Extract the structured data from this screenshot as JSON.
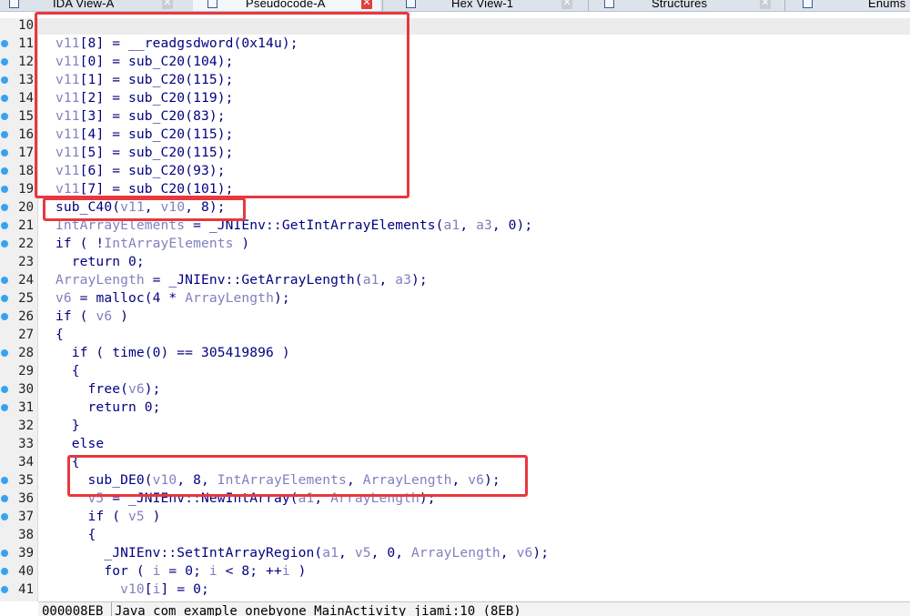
{
  "tabs": [
    {
      "label": "IDA View-A",
      "active": false,
      "icon": "disassembly-icon"
    },
    {
      "label": "Pseudocode-A",
      "active": true,
      "icon": "pseudocode-icon"
    },
    {
      "label": "Hex View-1",
      "active": false,
      "icon": "hex-icon"
    },
    {
      "label": "Structures",
      "active": false,
      "icon": "structures-icon"
    },
    {
      "label": "Enums",
      "active": false,
      "icon": "enums-icon"
    }
  ],
  "close_glyph": "✕",
  "code_lines": [
    {
      "n": "10",
      "dot": false,
      "text": ""
    },
    {
      "n": "11",
      "dot": true,
      "text": "v11[8] = __readgsdword(0x14u);"
    },
    {
      "n": "12",
      "dot": true,
      "text": "v11[0] = sub_C20(104);"
    },
    {
      "n": "13",
      "dot": true,
      "text": "v11[1] = sub_C20(115);"
    },
    {
      "n": "14",
      "dot": true,
      "text": "v11[2] = sub_C20(119);"
    },
    {
      "n": "15",
      "dot": true,
      "text": "v11[3] = sub_C20(83);"
    },
    {
      "n": "16",
      "dot": true,
      "text": "v11[4] = sub_C20(115);"
    },
    {
      "n": "17",
      "dot": true,
      "text": "v11[5] = sub_C20(115);"
    },
    {
      "n": "18",
      "dot": true,
      "text": "v11[6] = sub_C20(93);"
    },
    {
      "n": "19",
      "dot": true,
      "text": "v11[7] = sub_C20(101);"
    },
    {
      "n": "20",
      "dot": true,
      "text": "sub_C40(v11, v10, 8);"
    },
    {
      "n": "21",
      "dot": true,
      "text": "IntArrayElements = _JNIEnv::GetIntArrayElements(a1, a3, 0);"
    },
    {
      "n": "22",
      "dot": true,
      "text": "if ( !IntArrayElements )"
    },
    {
      "n": "23",
      "dot": false,
      "text": "  return 0;"
    },
    {
      "n": "24",
      "dot": true,
      "text": "ArrayLength = _JNIEnv::GetArrayLength(a1, a3);"
    },
    {
      "n": "25",
      "dot": true,
      "text": "v6 = malloc(4 * ArrayLength);"
    },
    {
      "n": "26",
      "dot": true,
      "text": "if ( v6 )"
    },
    {
      "n": "27",
      "dot": false,
      "text": "{"
    },
    {
      "n": "28",
      "dot": true,
      "text": "  if ( time(0) == 305419896 )"
    },
    {
      "n": "29",
      "dot": false,
      "text": "  {"
    },
    {
      "n": "30",
      "dot": true,
      "text": "    free(v6);"
    },
    {
      "n": "31",
      "dot": true,
      "text": "    return 0;"
    },
    {
      "n": "32",
      "dot": false,
      "text": "  }"
    },
    {
      "n": "33",
      "dot": false,
      "text": "  else"
    },
    {
      "n": "34",
      "dot": false,
      "text": "  {"
    },
    {
      "n": "35",
      "dot": true,
      "text": "    sub_DE0(v10, 8, IntArrayElements, ArrayLength, v6);"
    },
    {
      "n": "36",
      "dot": true,
      "text": "    v5 = _JNIEnv::NewIntArray(a1, ArrayLength);"
    },
    {
      "n": "37",
      "dot": true,
      "text": "    if ( v5 )"
    },
    {
      "n": "38",
      "dot": false,
      "text": "    {"
    },
    {
      "n": "39",
      "dot": true,
      "text": "      _JNIEnv::SetIntArrayRegion(a1, v5, 0, ArrayLength, v6);"
    },
    {
      "n": "40",
      "dot": true,
      "text": "      for ( i = 0; i < 8; ++i )"
    },
    {
      "n": "41",
      "dot": true,
      "text": "        v10[i] = 0;"
    }
  ],
  "variables": [
    "v11",
    "v10",
    "v6",
    "v5",
    "a1",
    "a3",
    "i",
    "IntArrayElements",
    "ArrayLength"
  ],
  "status": {
    "address": "000008EB",
    "location": "Java_com_example_onebyone_MainActivity_jiami:10 (8EB)"
  },
  "colors": {
    "code": "#000080",
    "variable": "#8080c0",
    "annotation": "#e8383d",
    "line_marker": "#37a3f0"
  }
}
